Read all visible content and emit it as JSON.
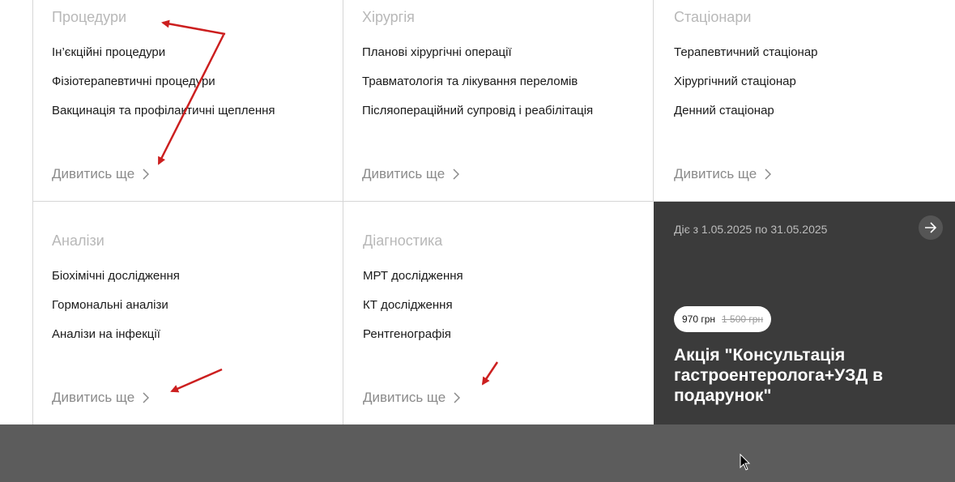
{
  "categories": [
    {
      "title": "Процедури",
      "links": [
        "Ін’єкційні процедури",
        "Фізіотерапевтичні процедури",
        "Вакцинація та профілактичні щеплення"
      ],
      "more": "Дивитись ще"
    },
    {
      "title": "Хірургія",
      "links": [
        "Планові хірургічні операції",
        "Травматологія та лікування переломів",
        "Післяопераційний супровід і реабілітація"
      ],
      "more": "Дивитись ще"
    },
    {
      "title": "Стаціонари",
      "links": [
        "Терапевтичний стаціонар",
        "Хірургічний стаціонар",
        "Денний стаціонар"
      ],
      "more": "Дивитись ще"
    },
    {
      "title": "Аналізи",
      "links": [
        "Біохімічні дослідження",
        "Гормональні аналізи",
        "Аналізи на інфекції"
      ],
      "more": "Дивитись ще"
    },
    {
      "title": "Діагностика",
      "links": [
        "МРТ дослідження",
        "КТ дослідження",
        "Рентгенографія"
      ],
      "more": "Дивитись ще"
    }
  ],
  "promo": {
    "dates": "Діє з 1.05.2025 по 31.05.2025",
    "price": "970 грн",
    "old_price": "1 500 грн",
    "headline": "Акція \"Консультація гастроентеролога+УЗД в подарунок\"",
    "arrow_icon": "arrow-right-icon"
  },
  "colors": {
    "promo_bg": "#3b3b3b",
    "annotation_red": "#cc1f1f",
    "footer_bg": "#5c5c5c"
  }
}
